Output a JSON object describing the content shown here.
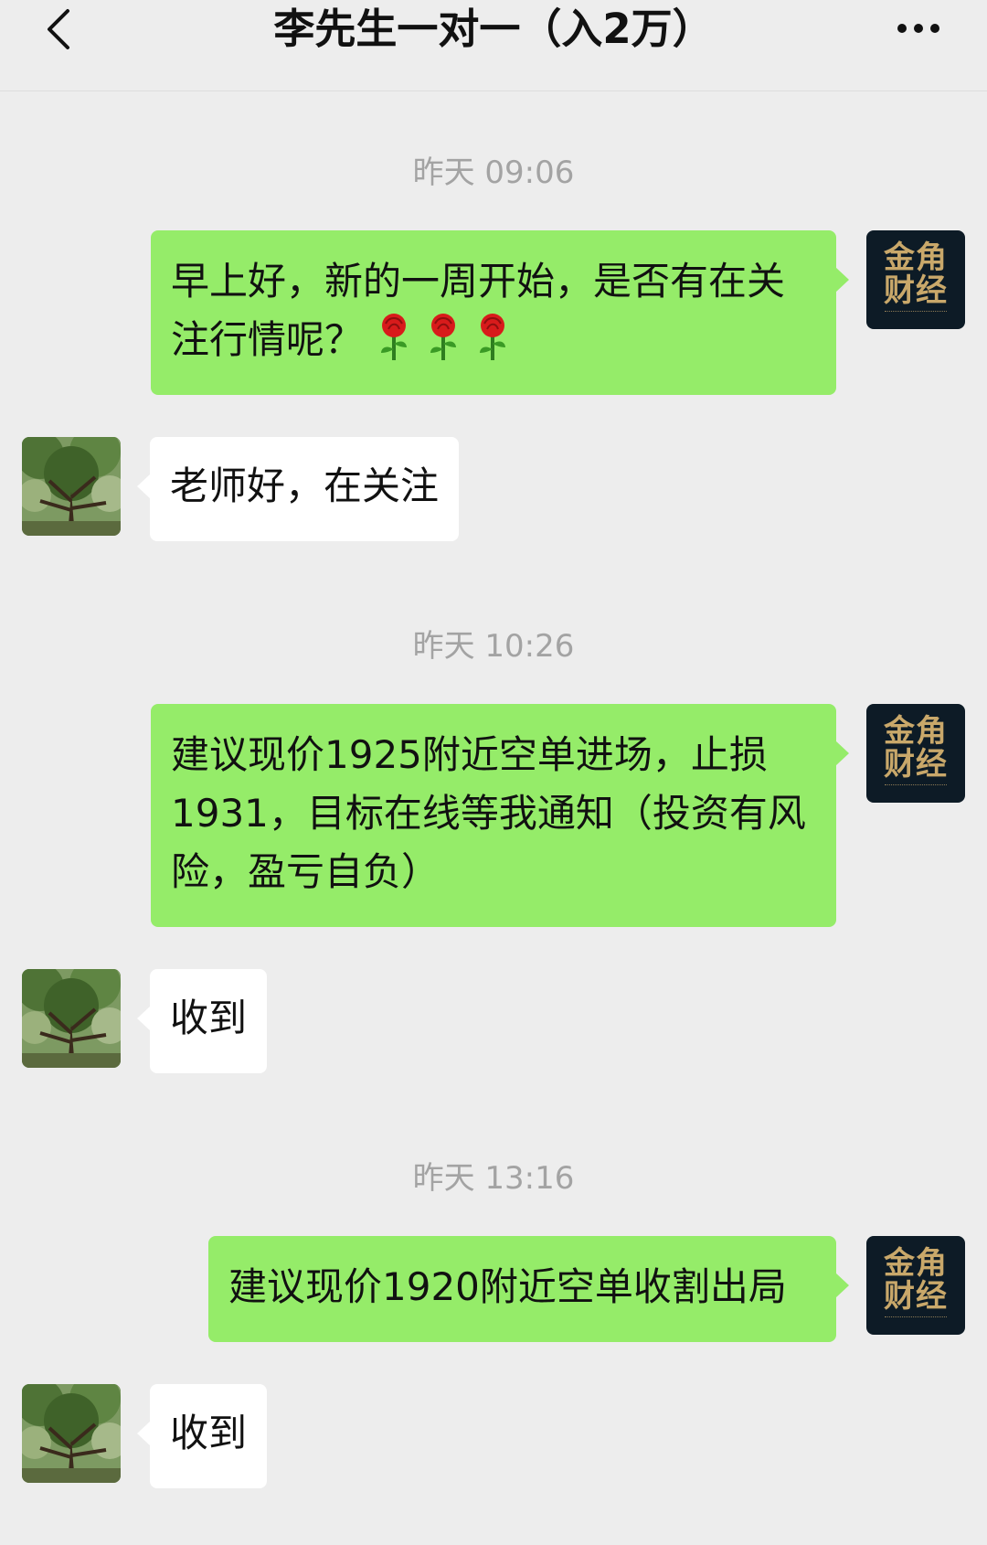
{
  "header": {
    "title": "李先生一对一（入2万）"
  },
  "me": {
    "avatar_line1": "金角",
    "avatar_line2": "财经"
  },
  "messages": [
    {
      "type": "time",
      "text": "昨天 09:06"
    },
    {
      "type": "sent",
      "text": "早上好，新的一周开始，是否有在关注行情呢？",
      "emoji": [
        "rose",
        "rose",
        "rose"
      ]
    },
    {
      "type": "received",
      "text": "老师好，在关注"
    },
    {
      "type": "time",
      "text": "昨天 10:26"
    },
    {
      "type": "sent",
      "text": "建议现价1925附近空单进场，止损1931，目标在线等我通知（投资有风险，盈亏自负）"
    },
    {
      "type": "received",
      "text": "收到"
    },
    {
      "type": "time",
      "text": "昨天 13:16"
    },
    {
      "type": "sent",
      "text": "建议现价1920附近空单收割出局"
    },
    {
      "type": "received",
      "text": "收到"
    }
  ],
  "colors": {
    "background": "#ededed",
    "sent_bubble": "#95ec69",
    "received_bubble": "#ffffff",
    "timestamp_text": "#a3a3a3",
    "logo_gold": "#c9a86a",
    "logo_bg": "#0d1b26"
  }
}
